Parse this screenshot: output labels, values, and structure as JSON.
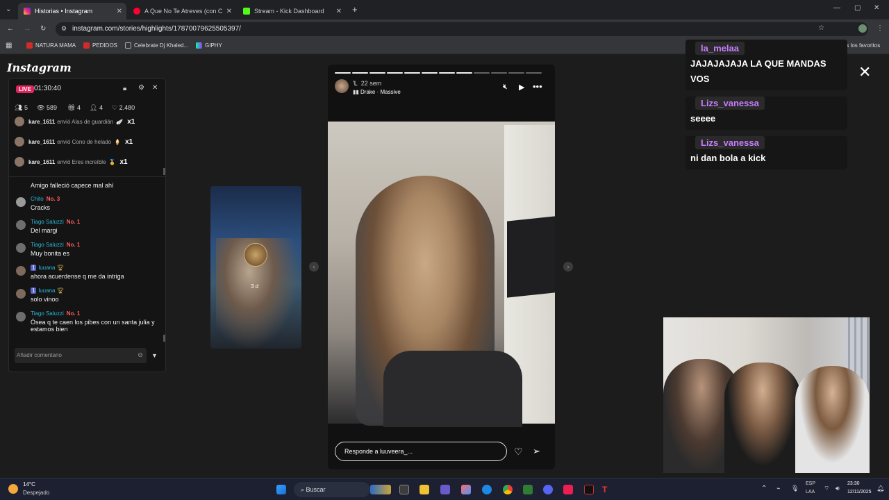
{
  "browser": {
    "tabs": [
      {
        "title": "Historias • Instagram",
        "active": true
      },
      {
        "title": "A Que No Te Atreves (con C",
        "active": false
      },
      {
        "title": "Stream - Kick Dashboard",
        "active": false
      }
    ],
    "url": "instagram.com/stories/highlights/17870079625505397/",
    "bookmarks": [
      "NATURA MAMA",
      "PEDIDOS",
      "Celebrate Dj Khaled...",
      "GIPHY"
    ],
    "bookmarks_right": "Todos los favoritos",
    "new_tab": "+"
  },
  "instagram": {
    "logo": "Instagram"
  },
  "chat_widget": {
    "live": "LIVE",
    "timer": "01:30:40",
    "stats": [
      "5",
      "589",
      "4",
      "4",
      "2.480"
    ],
    "gifts": [
      {
        "user": "kare_1611",
        "text": "envió Alas de guardián",
        "count": "x1"
      },
      {
        "user": "kare_1611",
        "text": "envió Cono de helado",
        "count": "x1"
      },
      {
        "user": "kare_1611",
        "text": "envió Eres increíble",
        "count": "x1"
      }
    ],
    "messages": [
      {
        "name": "",
        "badge": "",
        "text": "Amigo falleció capece mal ahí"
      },
      {
        "name": "Chito",
        "badge": "No. 3",
        "text": "Cracks"
      },
      {
        "name": "Tiago Saluzzi",
        "badge": "No. 1",
        "text": "Del margi"
      },
      {
        "name": "Tiago Saluzzi",
        "badge": "No. 1",
        "text": "Muy bonita es"
      },
      {
        "name": "luuana",
        "badge": "1",
        "text": "ahora acuerdense q me da intriga"
      },
      {
        "name": "luuana",
        "badge": "1",
        "text": "solo vinoo"
      },
      {
        "name": "Tiago Saluzzi",
        "badge": "No. 1",
        "text": "Ósea q te caen los pibes con un santa julia y estamos bien"
      }
    ],
    "comment_placeholder": "Añadir comentario"
  },
  "prev_story": {
    "text": "3 d"
  },
  "story": {
    "username": "'L",
    "age": "22 sem",
    "music": "Drake · Massive",
    "reply_placeholder": "Responde a luuveera_...",
    "progress_total": 12,
    "progress_done": 8
  },
  "overlay_chat": [
    {
      "name": "la_melaa",
      "text": "JAJAJAJAJA LA QUE MANDAS VOS"
    },
    {
      "name": "Lizs_vanessa",
      "text": "seeee"
    },
    {
      "name": "Lizs_vanessa",
      "text": "ni dan bola a kick"
    }
  ],
  "taskbar": {
    "weather_temp": "14°C",
    "weather_desc": "Despejado",
    "search": "Buscar",
    "lang1": "ESP",
    "lang2": "LAA",
    "time": "23:30",
    "date": "12/11/2025"
  },
  "colors": {
    "accent_live": "#e0245e",
    "overlay_name": "#c77dff",
    "chat_name": "#29b6d6"
  }
}
